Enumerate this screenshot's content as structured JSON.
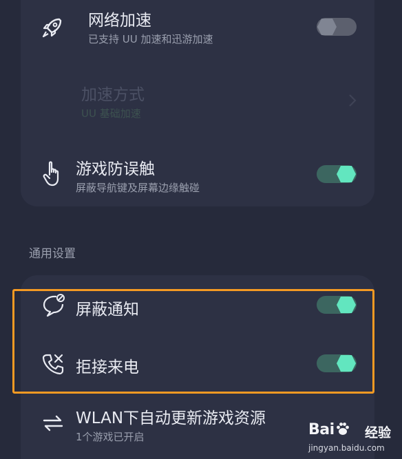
{
  "settings": {
    "network_boost": {
      "title": "网络加速",
      "subtitle": "已支持 UU 加速和迅游加速",
      "icon": "rocket-icon",
      "enabled": false
    },
    "boost_mode": {
      "title": "加速方式",
      "subtitle": "UU 基础加速",
      "icon": "chevron-right-icon",
      "disabled": true
    },
    "touch_guard": {
      "title": "游戏防误触",
      "subtitle": "屏蔽导航键及屏幕边缘触碰",
      "icon": "hand-pointer-icon",
      "enabled": true
    }
  },
  "general": {
    "section_label": "通用设置",
    "block_notifications": {
      "title": "屏蔽通知",
      "icon": "message-block-icon",
      "enabled": true
    },
    "reject_calls": {
      "title": "拒接来电",
      "icon": "phone-block-icon",
      "enabled": true
    },
    "wlan_update": {
      "title": "WLAN下自动更新游戏资源",
      "subtitle": "1个游戏已开启",
      "icon": "sync-arrows-icon"
    }
  },
  "watermark": {
    "brand_left": "Bai",
    "brand_right": "经验",
    "url": "jingyan.baidu.com"
  },
  "colors": {
    "background": "#262a3b",
    "card": "#2d3144",
    "toggle_on_track": "#3c6660",
    "toggle_on_knob": "#62e6bf",
    "toggle_off_track": "#5c606e",
    "highlight": "#f59a23"
  }
}
